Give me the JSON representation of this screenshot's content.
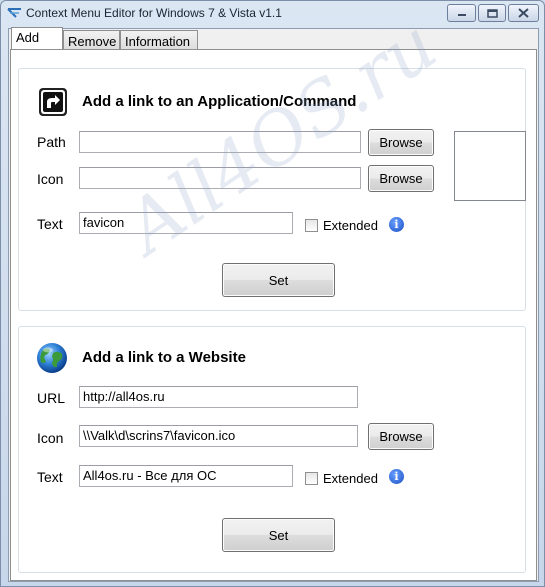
{
  "window": {
    "title": "Context Menu Editor for Windows 7 & Vista v1.1"
  },
  "tabs": [
    {
      "label": "Add",
      "active": true
    },
    {
      "label": "Remove",
      "active": false
    },
    {
      "label": "Information",
      "active": false
    }
  ],
  "application_group": {
    "heading": "Add a link to an Application/Command",
    "path_label": "Path",
    "path_value": "",
    "icon_label": "Icon",
    "icon_value": "",
    "text_label": "Text",
    "text_value": "favicon",
    "browse_label": "Browse",
    "extended_label": "Extended",
    "extended_checked": false,
    "set_label": "Set"
  },
  "website_group": {
    "heading": "Add a link to a Website",
    "url_label": "URL",
    "url_value": "http://all4os.ru",
    "icon_label": "Icon",
    "icon_value": "\\\\Valk\\d\\scrins7\\favicon.ico",
    "text_label": "Text",
    "text_value": "All4os.ru - Все для ОС",
    "browse_label": "Browse",
    "extended_label": "Extended",
    "extended_checked": false,
    "set_label": "Set"
  },
  "watermark": "All4OS.ru",
  "icons": {
    "app": "shortcut-arrow-icon",
    "web": "globe-icon",
    "info": "info-icon"
  },
  "colors": {
    "accent_info": "#1a4fc4",
    "window_frame": "#c7d6ea"
  }
}
